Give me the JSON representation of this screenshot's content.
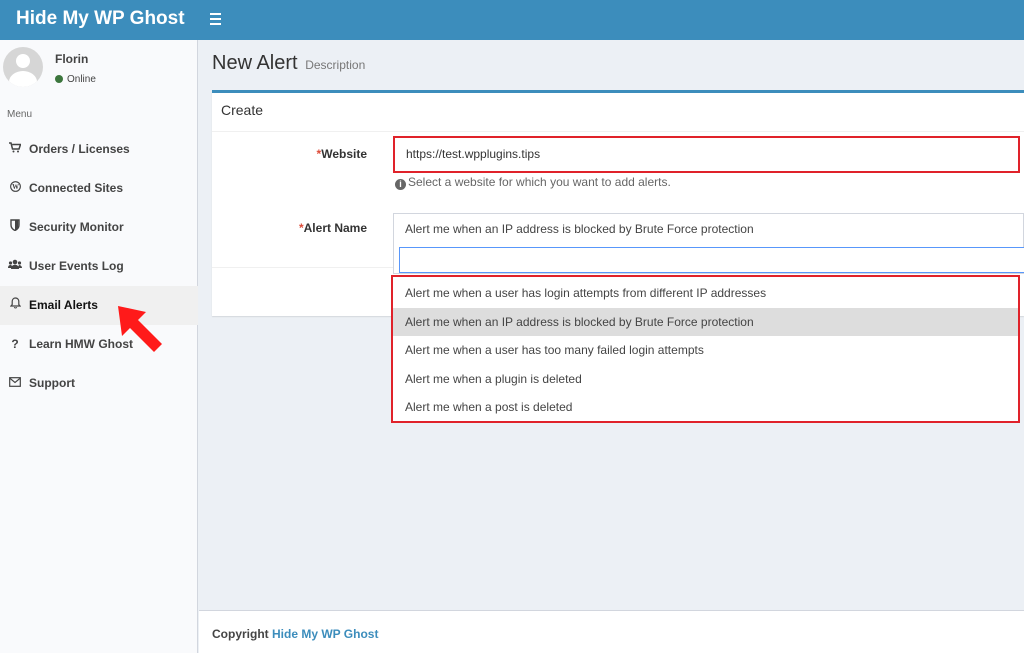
{
  "app": {
    "logo": "Hide My WP Ghost"
  },
  "user": {
    "name": "Florin",
    "status": "Online"
  },
  "sidebar": {
    "header": "Menu",
    "items": [
      {
        "label": "Orders / Licenses",
        "icon": "cart-icon"
      },
      {
        "label": "Connected Sites",
        "icon": "wordpress-icon"
      },
      {
        "label": "Security Monitor",
        "icon": "shield-icon"
      },
      {
        "label": "User Events Log",
        "icon": "users-icon"
      },
      {
        "label": "Email Alerts",
        "icon": "bell-icon",
        "active": true
      },
      {
        "label": "Learn HMW Ghost",
        "icon": "question-icon"
      },
      {
        "label": "Support",
        "icon": "envelope-icon"
      }
    ]
  },
  "page": {
    "title": "New Alert",
    "subtitle": "Description"
  },
  "form": {
    "box_title": "Create",
    "required_mark": "*",
    "website_label": "Website",
    "website_value": "https://test.wpplugins.tips",
    "website_help": "Select a website for which you want to add alerts.",
    "alert_label": "Alert Name",
    "alert_selected": "Alert me when an IP address is blocked by Brute Force protection",
    "options": [
      "Alert me when a user has login attempts from different IP addresses",
      "Alert me when an IP address is blocked by Brute Force protection",
      "Alert me when a user has too many failed login attempts",
      "Alert me when a plugin is deleted",
      "Alert me when a post is deleted"
    ]
  },
  "footer": {
    "prefix": "Copyright",
    "link": "Hide My WP Ghost"
  },
  "colors": {
    "header": "#3c8dbc",
    "highlight": "#e0222a",
    "arrow": "#ff1a1a"
  }
}
